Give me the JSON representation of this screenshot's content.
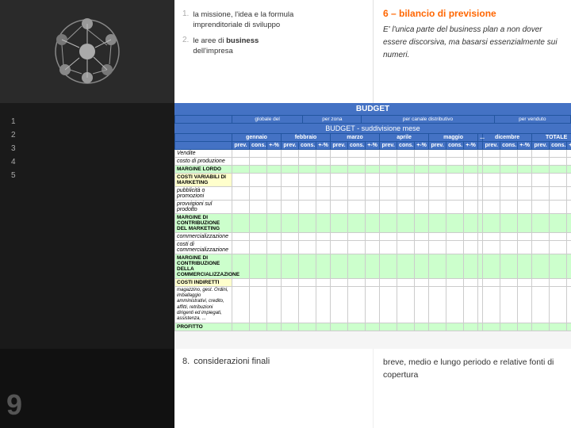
{
  "layout": {
    "top_left_image_alt": "business network diagram"
  },
  "steps": {
    "step1": {
      "number": "1.",
      "line1": "la missione, l'idea e la formula",
      "line2": "imprenditoriale di sviluppo"
    },
    "step2": {
      "number": "2.",
      "line1": "le",
      "line2": "aree",
      "line3": "di",
      "line4": "business",
      "line5": "dell'impresa"
    },
    "step8": {
      "number": "8.",
      "label": "considerazioni finali"
    }
  },
  "header": {
    "title": "6 – bilancio di previsione",
    "description": "E' l'unica parte del business plan a non dover essere discorsiva, ma basarsi essenzialmente sui numeri."
  },
  "right_note": {
    "line1": "breve, medio e lungo periodo e",
    "line2": "relative fonti di copertura"
  },
  "budget": {
    "title": "BUDGET",
    "subtitle": "BUDGET - suddivisione mese",
    "header_row1": [
      "",
      "gennaio",
      "",
      "",
      "febbraio",
      "",
      "",
      "marzo",
      "",
      "",
      "aprile",
      "",
      "",
      "maggio",
      "",
      "...",
      "dicembre",
      "",
      "",
      "TOTALE",
      "",
      ""
    ],
    "header_row2": [
      "",
      "prev.",
      "cons.",
      "+-%",
      "prev.",
      "cons.",
      "+-%",
      "prev.",
      "cons.",
      "+-%",
      "prev.",
      "cons.",
      "+-%",
      "prev.",
      "cons.",
      "+-%",
      "prev.",
      "cons.",
      "+-%",
      "prev.",
      "cons.",
      "+-%"
    ],
    "top_cols": [
      "globale del",
      "",
      "per zona",
      "",
      "per canale distributivo",
      "",
      "per venduto",
      ""
    ],
    "rows": [
      {
        "label": "Vendite",
        "type": "normal",
        "bold": false
      },
      {
        "label": "costo di produzione",
        "type": "normal",
        "bold": false
      },
      {
        "label": "margine LORDO",
        "type": "bold",
        "bold": true
      },
      {
        "label": "costi variabili di marketing",
        "type": "bold",
        "bold": true
      },
      {
        "label": "pubblicità o promozioni",
        "type": "normal",
        "bold": false
      },
      {
        "label": "provvigioni sul prodotto",
        "type": "normal",
        "bold": false
      },
      {
        "label": "margine di CONTRIBUZIONE del marketing",
        "type": "green",
        "bold": true
      },
      {
        "label": "commercializzazione",
        "type": "italic",
        "bold": false
      },
      {
        "label": "costi di commercializzazione",
        "type": "normal",
        "bold": false
      },
      {
        "label": "margine di CONTRIBUZIONE della commercializzazione",
        "type": "green",
        "bold": true
      },
      {
        "label": "costi indiretti",
        "type": "bold",
        "bold": true
      },
      {
        "label": "magazzino, gest. Ordini, imballaggio amministrativi, credito, affitti, retribuzioni dirigenti ed impiegati, assistenza, ...",
        "type": "normal",
        "bold": false
      },
      {
        "label": "profitto",
        "type": "green",
        "bold": true
      }
    ]
  },
  "left_panel_steps": [
    {
      "num": "1",
      "text": "la missione, l'idea e la formula imprenditoriale di sviluppo",
      "active": false
    },
    {
      "num": "2",
      "text": "le aree di business dell'impresa",
      "active": false
    },
    {
      "num": "6",
      "text": "bilancio di previsione",
      "active": true
    }
  ],
  "bottom": {
    "step8_num": "8.",
    "step8_label": "considerazioni finali",
    "right_text": "breve, medio e lungo periodo e relative fonti di copertura"
  }
}
